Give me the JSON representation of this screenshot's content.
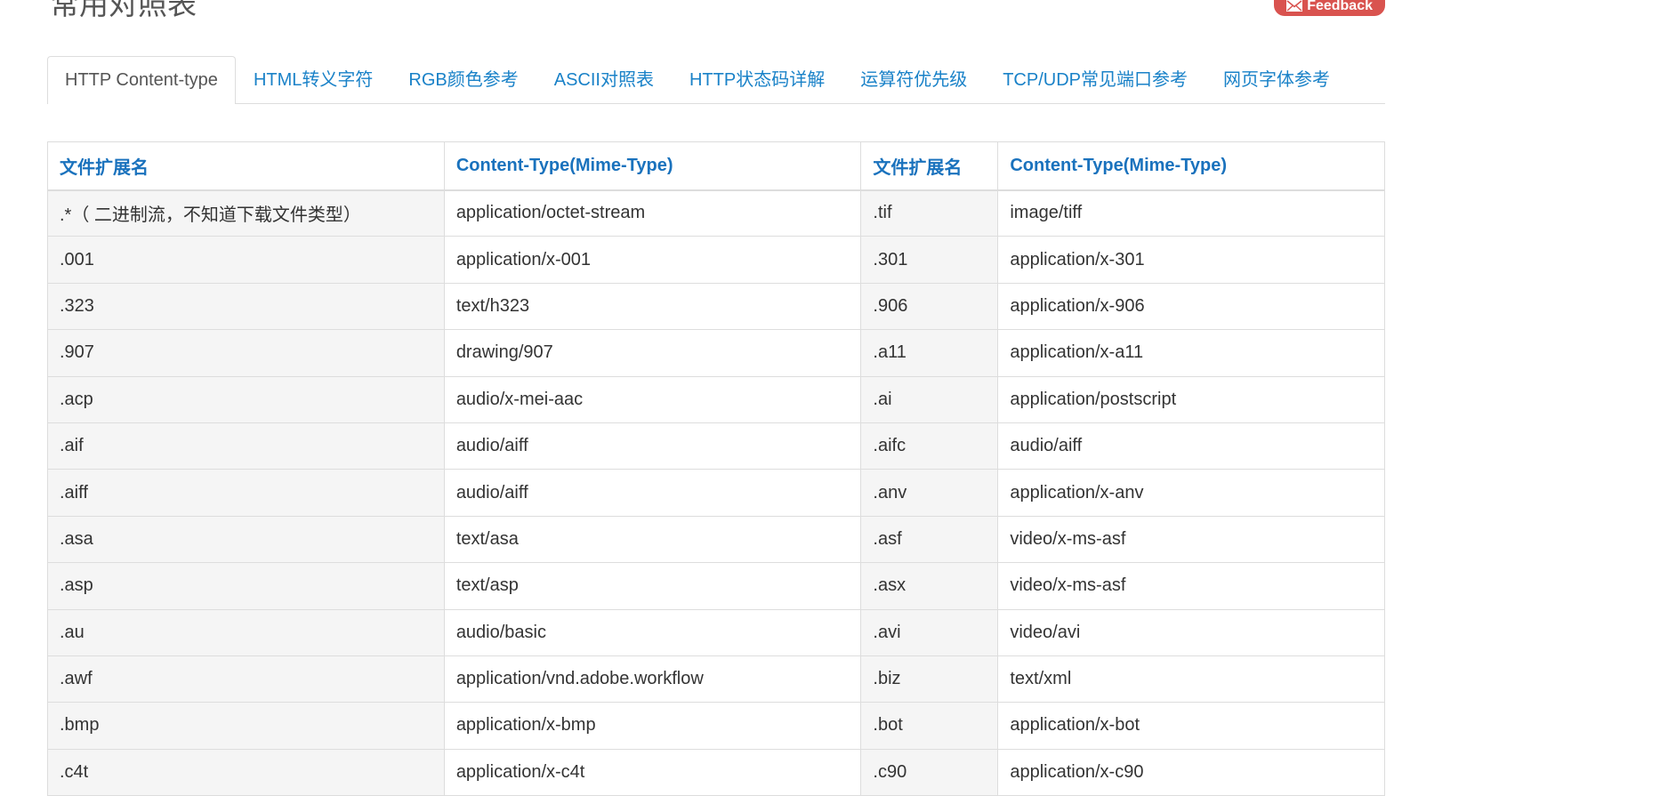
{
  "page": {
    "title": "常用对照表",
    "feedback_label": "Feedback"
  },
  "tabs": [
    {
      "label": "HTTP Content-type",
      "active": true
    },
    {
      "label": "HTML转义字符",
      "active": false
    },
    {
      "label": "RGB颜色参考",
      "active": false
    },
    {
      "label": "ASCII对照表",
      "active": false
    },
    {
      "label": "HTTP状态码详解",
      "active": false
    },
    {
      "label": "运算符优先级",
      "active": false
    },
    {
      "label": "TCP/UDP常见端口参考",
      "active": false
    },
    {
      "label": "网页字体参考",
      "active": false
    }
  ],
  "table": {
    "headers": [
      "文件扩展名",
      "Content-Type(Mime-Type)",
      "文件扩展名",
      "Content-Type(Mime-Type)"
    ],
    "rows": [
      [
        ".*（ 二进制流，不知道下载文件类型）",
        "application/octet-stream",
        ".tif",
        "image/tiff"
      ],
      [
        ".001",
        "application/x-001",
        ".301",
        "application/x-301"
      ],
      [
        ".323",
        "text/h323",
        ".906",
        "application/x-906"
      ],
      [
        ".907",
        "drawing/907",
        ".a11",
        "application/x-a11"
      ],
      [
        ".acp",
        "audio/x-mei-aac",
        ".ai",
        "application/postscript"
      ],
      [
        ".aif",
        "audio/aiff",
        ".aifc",
        "audio/aiff"
      ],
      [
        ".aiff",
        "audio/aiff",
        ".anv",
        "application/x-anv"
      ],
      [
        ".asa",
        "text/asa",
        ".asf",
        "video/x-ms-asf"
      ],
      [
        ".asp",
        "text/asp",
        ".asx",
        "video/x-ms-asf"
      ],
      [
        ".au",
        "audio/basic",
        ".avi",
        "video/avi"
      ],
      [
        ".awf",
        "application/vnd.adobe.workflow",
        ".biz",
        "text/xml"
      ],
      [
        ".bmp",
        "application/x-bmp",
        ".bot",
        "application/x-bot"
      ],
      [
        ".c4t",
        "application/x-c4t",
        ".c90",
        "application/x-c90"
      ]
    ]
  },
  "colors": {
    "link": "#1a82c8",
    "header_text": "#1a72bd",
    "feedback_bg": "#d9534f",
    "ext_cell_bg": "#f5f5f5",
    "border": "#dddddd"
  },
  "icons": {
    "feedback": "envelope-icon"
  }
}
